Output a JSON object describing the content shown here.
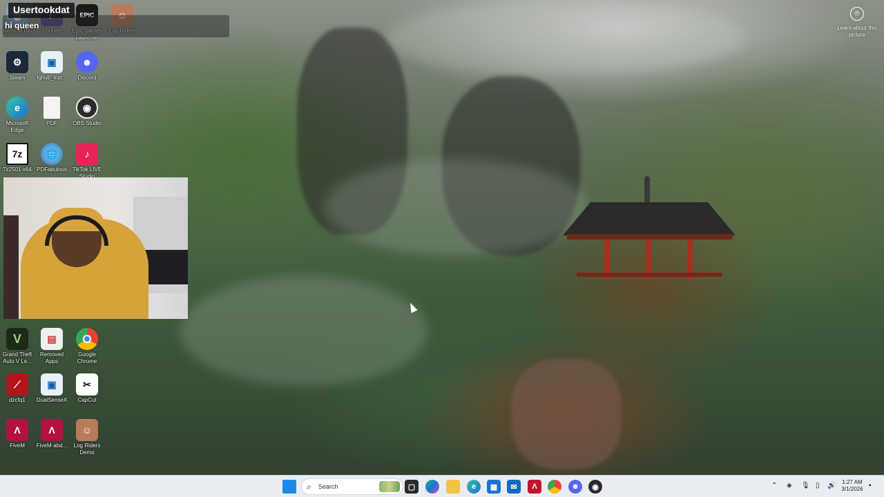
{
  "stream_overlay": {
    "username": "Usertookdat",
    "chat_message": "hi queen"
  },
  "desktop_icons": [
    {
      "label": "Recycle Bin",
      "icon": "recycle-bin-icon"
    },
    {
      "label": "Fortnite",
      "icon": "fortnite-icon"
    },
    {
      "label": "Epic Games Launcher",
      "icon": "epic-games-icon",
      "glyph": "EPIC"
    },
    {
      "label": "Log Riders",
      "icon": "log-riders-icon"
    },
    {
      "label": "Steam",
      "icon": "steam-icon"
    },
    {
      "label": "lghub_inst...",
      "icon": "installer-icon"
    },
    {
      "label": "Discord",
      "icon": "discord-icon"
    },
    {
      "label": "Microsoft Edge",
      "icon": "edge-icon"
    },
    {
      "label": "PDF",
      "icon": "pdf-file-icon"
    },
    {
      "label": "OBS Studio",
      "icon": "obs-icon"
    },
    {
      "label": "7z2501-x64",
      "icon": "7zip-icon",
      "glyph": "7z"
    },
    {
      "label": "PDFabulous",
      "icon": "globe-icon"
    },
    {
      "label": "TikTok LIVE Studio",
      "icon": "tiktok-icon"
    },
    {
      "label": "Grand Theft Auto V Le...",
      "icon": "gta-icon",
      "glyph": "V"
    },
    {
      "label": "Removed Apps",
      "icon": "removed-apps-icon"
    },
    {
      "label": "Google Chrome",
      "icon": "chrome-icon"
    },
    {
      "label": "dzcfq1",
      "icon": "dzcfq-icon"
    },
    {
      "label": "DualSenseX",
      "icon": "dualsensex-icon"
    },
    {
      "label": "CapCut",
      "icon": "capcut-icon"
    },
    {
      "label": "FiveM",
      "icon": "fivem-icon"
    },
    {
      "label": "FiveM-abd...",
      "icon": "fivem-icon"
    },
    {
      "label": "Log Riders Demo",
      "icon": "log-riders-icon"
    }
  ],
  "learn_about": {
    "label": "Learn about this picture",
    "icon": "camera-icon"
  },
  "taskbar": {
    "search_placeholder": "Search",
    "apps": [
      "start-icon",
      "file-explorer-icon",
      "copilot-icon",
      "folder-icon",
      "edge-icon",
      "store-icon",
      "outlook-icon",
      "acrobat-icon",
      "chrome-icon",
      "discord-icon",
      "obs-icon"
    ],
    "tray": {
      "time": "1:27 AM",
      "date": "3/1/2026"
    }
  },
  "colors": {
    "taskbar_bg": "#e9edf2",
    "accent_blue": "#0078d4"
  }
}
